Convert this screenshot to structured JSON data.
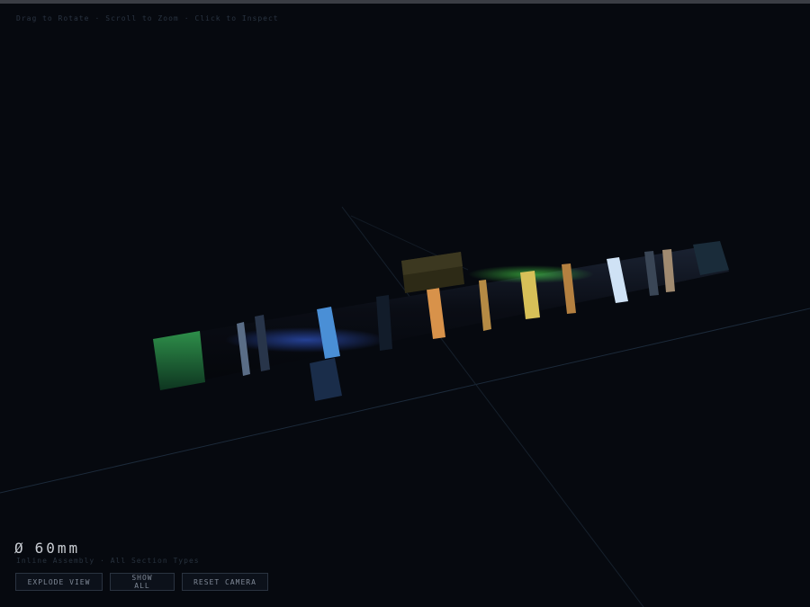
{
  "hints": [
    "Drag to Rotate",
    "Scroll to Zoom",
    "Click to Inspect"
  ],
  "readout": {
    "symbol": "Ø",
    "value": "60mm"
  },
  "subtitle": "Inline Assembly · All Section Types",
  "controls": {
    "explode": "EXPLODE VIEW",
    "show_all": "SHOW ALL",
    "reset": "RESET CAMERA"
  },
  "colors": {
    "background": "#06090f",
    "tube": "#0c0f18",
    "accent_blue": "#4a8fd6",
    "accent_orange": "#d8924a",
    "accent_yellow": "#d7c058",
    "accent_green": "#5bd65b",
    "accent_white": "#cfe2f5"
  }
}
